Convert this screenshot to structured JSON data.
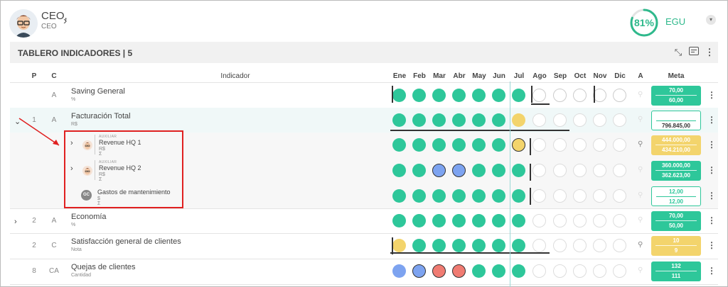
{
  "user": {
    "name": "CEO,",
    "role": "CEO"
  },
  "kpi": {
    "percent": "81%",
    "label": "EGU",
    "value": 0.81,
    "ring_color": "#2fb98c"
  },
  "board": {
    "title": "TABLERO INDICADORES | 5"
  },
  "columns": {
    "p": "P",
    "c": "C",
    "indicador": "Indicador",
    "a": "A",
    "meta": "Meta",
    "months": [
      "Ene",
      "Feb",
      "Mar",
      "Abr",
      "May",
      "Jun",
      "Jul",
      "Ago",
      "Sep",
      "Oct",
      "Nov",
      "Dic"
    ]
  },
  "rows": [
    {
      "p": "",
      "c": "A",
      "name": "Saving General",
      "unit": "%",
      "meta_top": "70,00",
      "meta_bottom": "60,00",
      "dots": [
        "g",
        "g",
        "g",
        "g",
        "g",
        "g",
        "g",
        "e",
        "e",
        "e",
        "e",
        "e"
      ]
    },
    {
      "p": "1",
      "c": "A",
      "name": "Facturación Total",
      "unit": "R$",
      "meta_top": "",
      "meta_bottom": "796.845,00",
      "dots": [
        "g",
        "g",
        "g",
        "g",
        "g",
        "g",
        "y",
        "ef",
        "ef",
        "ef",
        "ef",
        "ef"
      ]
    },
    {
      "p": "",
      "c": "",
      "aux": "AUXILIAR",
      "name": "Revenue HQ 1",
      "unit": "R$",
      "unit2": "Σ",
      "meta_top": "444.000,00",
      "meta_bottom": "434.210,00",
      "dots": [
        "g",
        "g",
        "g",
        "g",
        "g",
        "g",
        "yb",
        "ef",
        "ef",
        "ef",
        "ef",
        "ef"
      ]
    },
    {
      "p": "",
      "c": "",
      "aux": "AUXILIAR",
      "name": "Revenue HQ 2",
      "unit": "R$",
      "unit2": "Σ",
      "meta_top": "360.000,00",
      "meta_bottom": "362.623,00",
      "dots": [
        "g",
        "g",
        "b",
        "b",
        "g",
        "g",
        "g",
        "ef",
        "ef",
        "ef",
        "ef",
        "ef"
      ]
    },
    {
      "p": "",
      "c": "",
      "initials": "GC",
      "name": "Gastos de mantenimiento",
      "unit": "$",
      "unit2": "Σ",
      "meta_top": "12,00",
      "meta_bottom": "12,00",
      "dots": [
        "g",
        "g",
        "g",
        "g",
        "g",
        "g",
        "g",
        "ef",
        "ef",
        "ef",
        "ef",
        "ef"
      ]
    },
    {
      "p": "2",
      "c": "A",
      "name": "Economía",
      "unit": "%",
      "meta_top": "70,00",
      "meta_bottom": "50,00",
      "dots": [
        "g",
        "g",
        "g",
        "g",
        "g",
        "g",
        "g",
        "ef",
        "ef",
        "ef",
        "ef",
        "ef"
      ]
    },
    {
      "p": "2",
      "c": "C",
      "name": "Satisfacción general de clientes",
      "unit": "Nota",
      "meta_top": "10",
      "meta_bottom": "9",
      "dots": [
        "y",
        "g",
        "g",
        "g",
        "g",
        "g",
        "g",
        "ef",
        "ef",
        "ef",
        "ef",
        "ef"
      ]
    },
    {
      "p": "8",
      "c": "CA",
      "name": "Quejas de clientes",
      "unit": "Cantidad",
      "meta_top": "132",
      "meta_bottom": "111",
      "dots": [
        "bl",
        "b",
        "r",
        "r",
        "g",
        "g",
        "g",
        "ef",
        "ef",
        "ef",
        "ef",
        "ef"
      ]
    }
  ],
  "colors": {
    "green": "#2ec79a",
    "yellow": "#f3d46c",
    "red": "#f07b72",
    "blue": "#7da3f0",
    "annotation": "#e02020"
  }
}
